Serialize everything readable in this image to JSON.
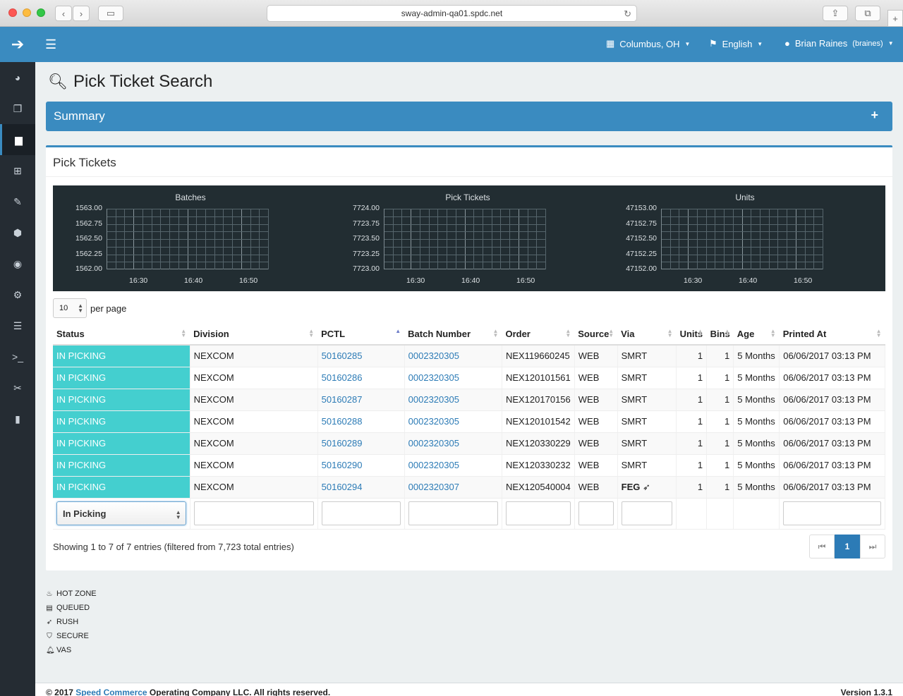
{
  "browser": {
    "url": "sway-admin-qa01.spdc.net"
  },
  "topnav": {
    "location": "Columbus, OH",
    "language": "English",
    "user_name": "Brian Raines",
    "user_login": "(braines)"
  },
  "page": {
    "title": "Pick Ticket Search"
  },
  "summary": {
    "title": "Summary",
    "toggle": "+"
  },
  "panel": {
    "title": "Pick Tickets"
  },
  "chart_data": [
    {
      "type": "line",
      "title": "Batches",
      "x": [
        "16:30",
        "16:40",
        "16:50"
      ],
      "series": [],
      "ylim": [
        1562.0,
        1563.0
      ],
      "yticks": [
        "1563.00",
        "1562.75",
        "1562.50",
        "1562.25",
        "1562.00"
      ],
      "xticks": [
        "16:30",
        "16:40",
        "16:50"
      ],
      "grid": true
    },
    {
      "type": "line",
      "title": "Pick Tickets",
      "x": [
        "16:30",
        "16:40",
        "16:50"
      ],
      "series": [],
      "ylim": [
        7723.0,
        7724.0
      ],
      "yticks": [
        "7724.00",
        "7723.75",
        "7723.50",
        "7723.25",
        "7723.00"
      ],
      "xticks": [
        "16:30",
        "16:40",
        "16:50"
      ],
      "grid": true
    },
    {
      "type": "line",
      "title": "Units",
      "x": [
        "16:30",
        "16:40",
        "16:50"
      ],
      "series": [],
      "ylim": [
        47152.0,
        47153.0
      ],
      "yticks": [
        "47153.00",
        "47152.75",
        "47152.50",
        "47152.25",
        "47152.00"
      ],
      "xticks": [
        "16:30",
        "16:40",
        "16:50"
      ],
      "grid": true
    }
  ],
  "table": {
    "per_page_value": "10",
    "per_page_label": "per page",
    "columns": [
      "Status",
      "Division",
      "PCTL",
      "Batch Number",
      "Order",
      "Source",
      "Via",
      "Units",
      "Bins",
      "Age",
      "Printed At"
    ],
    "rows": [
      {
        "status": "IN PICKING",
        "division": "NEXCOM",
        "pctl": "50160285",
        "batch": "0002320305",
        "order": "NEX119660245",
        "source": "WEB",
        "via": "SMRT",
        "units": "1",
        "bins": "1",
        "age": "5 Months",
        "printed": "06/06/2017 03:13 PM"
      },
      {
        "status": "IN PICKING",
        "division": "NEXCOM",
        "pctl": "50160286",
        "batch": "0002320305",
        "order": "NEX120101561",
        "source": "WEB",
        "via": "SMRT",
        "units": "1",
        "bins": "1",
        "age": "5 Months",
        "printed": "06/06/2017 03:13 PM"
      },
      {
        "status": "IN PICKING",
        "division": "NEXCOM",
        "pctl": "50160287",
        "batch": "0002320305",
        "order": "NEX120170156",
        "source": "WEB",
        "via": "SMRT",
        "units": "1",
        "bins": "1",
        "age": "5 Months",
        "printed": "06/06/2017 03:13 PM"
      },
      {
        "status": "IN PICKING",
        "division": "NEXCOM",
        "pctl": "50160288",
        "batch": "0002320305",
        "order": "NEX120101542",
        "source": "WEB",
        "via": "SMRT",
        "units": "1",
        "bins": "1",
        "age": "5 Months",
        "printed": "06/06/2017 03:13 PM"
      },
      {
        "status": "IN PICKING",
        "division": "NEXCOM",
        "pctl": "50160289",
        "batch": "0002320305",
        "order": "NEX120330229",
        "source": "WEB",
        "via": "SMRT",
        "units": "1",
        "bins": "1",
        "age": "5 Months",
        "printed": "06/06/2017 03:13 PM"
      },
      {
        "status": "IN PICKING",
        "division": "NEXCOM",
        "pctl": "50160290",
        "batch": "0002320305",
        "order": "NEX120330232",
        "source": "WEB",
        "via": "SMRT",
        "units": "1",
        "bins": "1",
        "age": "5 Months",
        "printed": "06/06/2017 03:13 PM"
      },
      {
        "status": "IN PICKING",
        "division": "NEXCOM",
        "pctl": "50160294",
        "batch": "0002320307",
        "order": "NEX120540004",
        "source": "WEB",
        "via": "FEG",
        "via_icon": "rocket-icon",
        "units": "1",
        "bins": "1",
        "age": "5 Months",
        "printed": "06/06/2017 03:13 PM"
      }
    ],
    "status_filter_value": "In Picking",
    "info": "Showing 1 to 7 of 7 entries (filtered from 7,723 total entries)",
    "current_page": "1"
  },
  "colors": {
    "brand": "#3a8bc0",
    "status_in_picking": "#44cfcf",
    "sidebar": "#252c33",
    "chart_bg": "#222d32"
  },
  "legend": [
    {
      "icon": "fire-icon",
      "label": "HOT ZONE"
    },
    {
      "icon": "clipboard-icon",
      "label": "QUEUED"
    },
    {
      "icon": "rocket-icon",
      "label": "RUSH"
    },
    {
      "icon": "shield-icon",
      "label": "SECURE"
    },
    {
      "icon": "bell-icon",
      "label": "VAS"
    }
  ],
  "footer": {
    "copy_prefix": "© 2017 ",
    "company_link": "Speed Commerce",
    "copy_suffix": " Operating Company LLC. All rights reserved.",
    "version": "Version 1.3.1"
  }
}
